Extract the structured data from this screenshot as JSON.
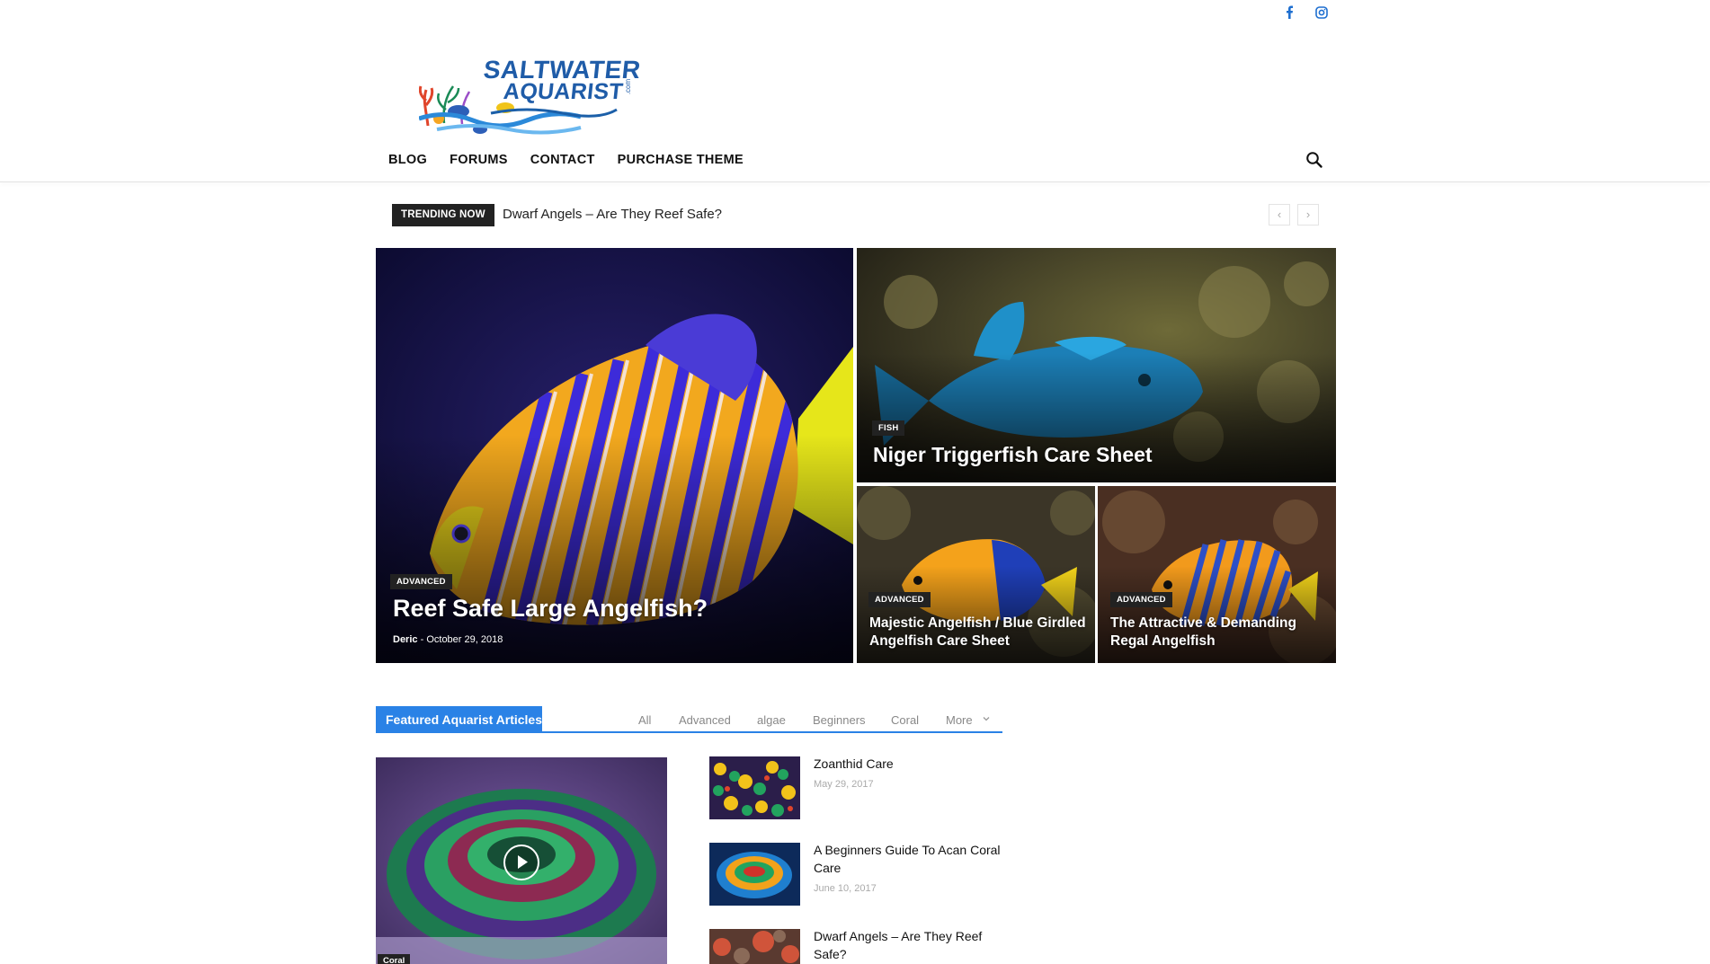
{
  "header": {
    "social": [
      "facebook-icon",
      "instagram-icon"
    ],
    "logo": {
      "line1": "SALTWATER",
      "line2": "AQUARIST",
      "suffix": ".com"
    },
    "nav": [
      "BLOG",
      "FORUMS",
      "CONTACT",
      "PURCHASE THEME"
    ]
  },
  "trending": {
    "badge": "TRENDING NOW",
    "headline": "Dwarf Angels – Are They Reef Safe?",
    "prev": "‹",
    "next": "›"
  },
  "hero": {
    "main": {
      "category": "ADVANCED",
      "title": "Reef Safe Large Angelfish?",
      "author": "Deric",
      "separator": "-",
      "date": "October 29, 2018"
    },
    "top_right": {
      "category": "FISH",
      "title": "Niger Triggerfish Care Sheet"
    },
    "bottom_left": {
      "category": "ADVANCED",
      "title": "Majestic Angelfish / Blue Girdled Angelfish Care Sheet"
    },
    "bottom_right": {
      "category": "ADVANCED",
      "title": "The Attractive & Demanding Regal Angelfish"
    }
  },
  "featured": {
    "heading": "Featured Aquarist Articles",
    "filters": [
      "All",
      "Advanced",
      "algae",
      "Beginners",
      "Coral",
      "More"
    ],
    "main_post": {
      "category": "Coral"
    },
    "posts": [
      {
        "title": "Zoanthid Care",
        "date": "May 29, 2017"
      },
      {
        "title": "A Beginners Guide To Acan Coral Care",
        "date": "June 10, 2017"
      },
      {
        "title": "Dwarf Angels – Are They Reef Safe?",
        "date": ""
      }
    ]
  },
  "colors": {
    "accent": "#2a82e6",
    "badge": "#222222"
  }
}
